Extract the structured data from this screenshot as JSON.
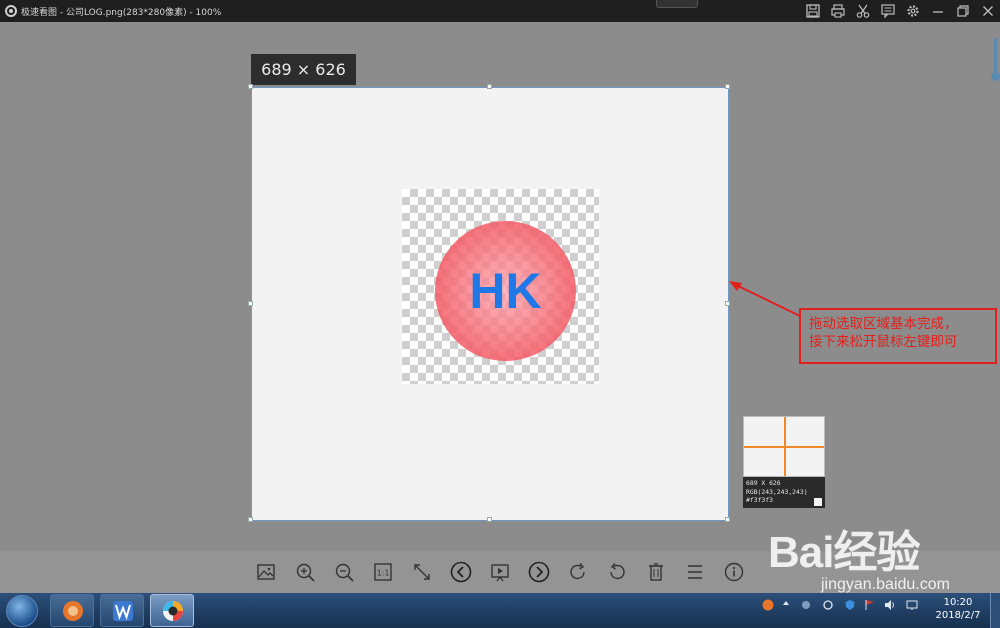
{
  "window": {
    "title": "极速看图 - 公司LOG.png(283*280像素) - 100%"
  },
  "titlebar_icons": [
    "save-icon",
    "print-icon",
    "cut-icon",
    "comment-icon",
    "settings-icon",
    "minimize-icon",
    "restore-icon",
    "close-icon"
  ],
  "selection": {
    "size_label": "689 × 626"
  },
  "image": {
    "logo_text": "HK",
    "logo_text_color": "#1e78e8",
    "circle_color": "#f25b66"
  },
  "annotation": {
    "line1": "拖动选取区域基本完成，",
    "line2": "接下来松开鼠标左键即可",
    "color": "#e3201b"
  },
  "magnifier": {
    "size": "689 X 626",
    "rgb": "RGB(243,243,243)",
    "hex": "#f3f3f3",
    "crosshair_color": "#f0882a"
  },
  "toolbar": {
    "items": [
      "image-icon",
      "zoom-in-icon",
      "zoom-out-icon",
      "actual-size-icon",
      "fit-screen-icon",
      "prev-icon",
      "slideshow-icon",
      "next-icon",
      "rotate-right-icon",
      "rotate-left-icon",
      "delete-icon",
      "menu-icon",
      "info-icon"
    ],
    "actual_size_label": "1:1"
  },
  "taskbar": {
    "apps": [
      "start-orb",
      "browser-app",
      "wps-app",
      "image-viewer-app"
    ],
    "time": "10:20",
    "date": "2018/2/7"
  },
  "watermark": {
    "brand": "Bai经验",
    "url": "jingyan.baidu.com"
  }
}
